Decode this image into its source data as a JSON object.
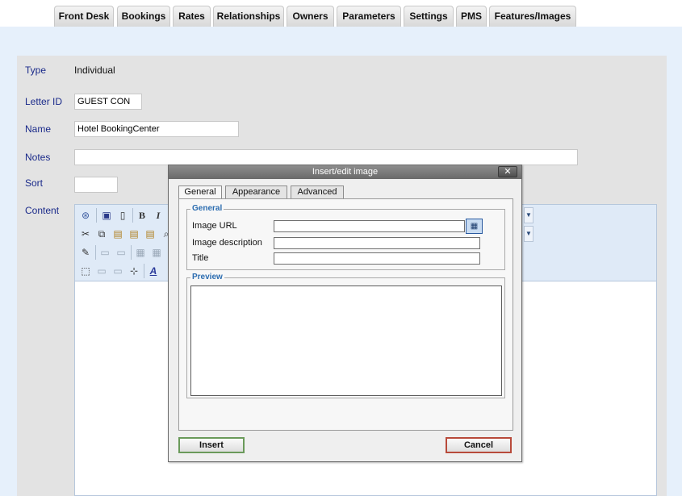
{
  "tabs": [
    {
      "label": "Front Desk"
    },
    {
      "label": "Bookings"
    },
    {
      "label": "Rates"
    },
    {
      "label": "Relationships"
    },
    {
      "label": "Owners"
    },
    {
      "label": "Parameters"
    },
    {
      "label": "Settings"
    },
    {
      "label": "PMS"
    },
    {
      "label": "Features/Images"
    }
  ],
  "form": {
    "type_label": "Type",
    "type_value": "Individual",
    "letter_id_label": "Letter ID",
    "letter_id_value": "GUEST CON",
    "name_label": "Name",
    "name_value": "Hotel BookingCenter",
    "notes_label": "Notes",
    "notes_value": "",
    "sort_label": "Sort",
    "sort_value": "",
    "content_label": "Content"
  },
  "toolbar": {
    "bold_label": "B",
    "italic_label": "I",
    "style_label": "A"
  },
  "dialog": {
    "title": "Insert/edit image",
    "close_label": "✕",
    "tabs": [
      {
        "label": "General",
        "active": true
      },
      {
        "label": "Appearance",
        "active": false
      },
      {
        "label": "Advanced",
        "active": false
      }
    ],
    "general_legend": "General",
    "image_url_label": "Image URL",
    "image_url_value": "",
    "image_description_label": "Image description",
    "image_description_value": "",
    "title_label": "Title",
    "title_value": "",
    "preview_legend": "Preview",
    "insert_label": "Insert",
    "cancel_label": "Cancel"
  },
  "colors": {
    "page_background": "#e6f0fb",
    "form_background": "#e3e3e3",
    "label_color": "#1a2a8a",
    "legend_color": "#2b6cb0",
    "insert_border": "#6a9a5a",
    "cancel_border": "#b84a3a"
  },
  "icons": [
    "cut-icon",
    "copy-icon",
    "paste-icon",
    "paste-text-icon",
    "paste-word-icon",
    "save-icon",
    "new-document-icon",
    "bold-icon",
    "italic-icon",
    "edit-icon",
    "table-icon",
    "dotted-box-icon",
    "font-style-icon",
    "close-icon",
    "browse-icon"
  ]
}
